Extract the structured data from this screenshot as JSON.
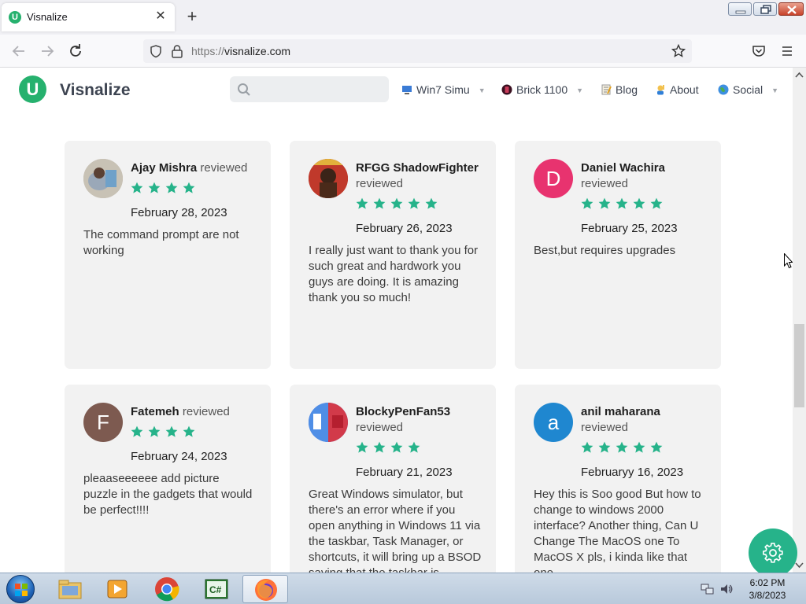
{
  "browser": {
    "tab_title": "Visnalize",
    "url_scheme": "https://",
    "url_host": "visnalize.com",
    "icons": [
      "back-icon",
      "forward-icon",
      "reload-icon",
      "shield-icon",
      "lock-icon",
      "star-icon",
      "pocket-icon",
      "menu-icon",
      "close-icon",
      "plus-icon"
    ]
  },
  "site": {
    "brand": "Visnalize",
    "logo_letter": "U",
    "search_placeholder": "",
    "nav": [
      {
        "label": "Win7 Simu",
        "has_dropdown": true
      },
      {
        "label": "Brick 1100",
        "has_dropdown": true
      },
      {
        "label": "Blog",
        "has_dropdown": false
      },
      {
        "label": "About",
        "has_dropdown": false
      },
      {
        "label": "Social",
        "has_dropdown": true
      }
    ]
  },
  "reviews": [
    {
      "name": "Ajay Mishra",
      "verb": "reviewed",
      "stars": 4,
      "date": "February 28, 2023",
      "text": "The command prompt are not working",
      "avatar_type": "photo"
    },
    {
      "name": "RFGG ShadowFighter",
      "verb": "reviewed",
      "stars": 5,
      "date": "February 26, 2023",
      "text": "I really just want to thank you for such great and hardwork you guys are doing. It is amazing thank you so much!",
      "avatar_type": "photo"
    },
    {
      "name": "Daniel Wachira",
      "verb": "reviewed",
      "stars": 5,
      "date": "February 25, 2023",
      "text": "Best,but requires upgrades",
      "avatar_letter": "D",
      "avatar_color": "#e8336f"
    },
    {
      "name": "Fatemeh",
      "verb": "reviewed",
      "stars": 4,
      "date": "February 24, 2023",
      "text": "pleaaseeeeee add picture puzzle in the gadgets that would be perfect!!!!",
      "avatar_letter": "F",
      "avatar_color": "#7d5a50"
    },
    {
      "name": "BlockyPenFan53",
      "verb": "reviewed",
      "stars": 4,
      "date": "February 21, 2023",
      "text": "Great Windows simulator, but there's an error where if you open anything in Windows 11 via the taskbar, Task Manager, or shortcuts, it will bring up a BSOD saying that the taskbar is",
      "avatar_type": "photo"
    },
    {
      "name": "anil maharana",
      "verb": "reviewed",
      "stars": 5,
      "date": "Februaryy 16, 2023",
      "text": "Hey this is Soo good But how to change to windows 2000 interface? Another thing, Can U Change The MacOS one To MacOS X pls, i kinda like that one",
      "avatar_letter": "a",
      "avatar_color": "#1f87d0"
    }
  ],
  "taskbar": {
    "time": "6:02 PM",
    "date": "3/8/2023"
  },
  "colors": {
    "accent": "#26b16e",
    "star": "#26b38a",
    "fab": "#26b38a"
  }
}
